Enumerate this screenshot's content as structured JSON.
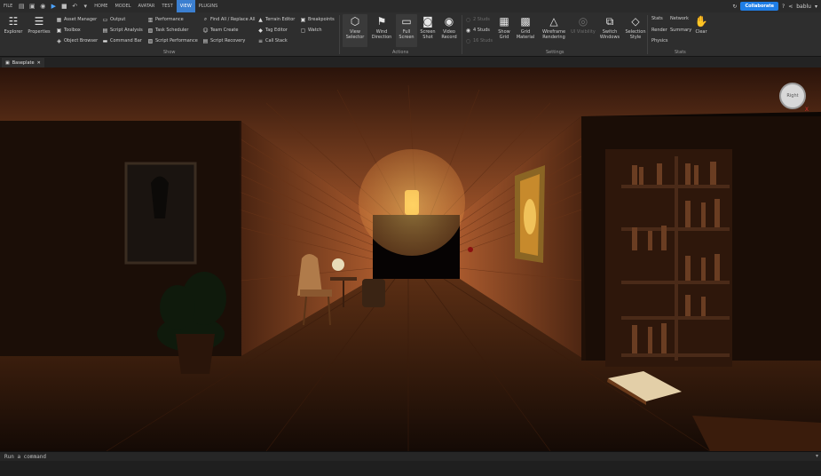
{
  "menubar": {
    "file": "FILE",
    "tabs": [
      "HOME",
      "MODEL",
      "AVATAR",
      "TEST",
      "VIEW",
      "PLUGINS"
    ],
    "active_tab": "VIEW",
    "collaborate": "Collaborate",
    "user": "bablu"
  },
  "ribbon": {
    "show": {
      "explorer": "Explorer",
      "properties": "Properties",
      "col1": [
        "Asset Manager",
        "Toolbox",
        "Object Browser"
      ],
      "col2": [
        "Output",
        "Script Analysis",
        "Command Bar"
      ],
      "col3": [
        "Performance",
        "Task Scheduler",
        "Script Performance"
      ],
      "col4": [
        "Find All / Replace All",
        "Team Create",
        "Script Recovery"
      ],
      "col5": [
        "Terrain Editor",
        "Tag Editor",
        "Call Stack"
      ],
      "col6": [
        "Breakpoints",
        "Watch"
      ],
      "label": "Show"
    },
    "actions": {
      "view_selector": "View\nSelector",
      "wind_direction": "Wind\nDirection",
      "full_screen": "Full\nScreen",
      "screen_shot": "Screen\nShot",
      "video_record": "Video\nRecord",
      "label": "Actions"
    },
    "settings": {
      "studs": [
        "2 Studs",
        "4 Studs",
        "16 Studs"
      ],
      "show_grid": "Show\nGrid",
      "grid_material": "Grid\nMaterial",
      "wireframe": "Wireframe\nRendering",
      "ui_visibility": "UI Visibility",
      "switch_windows": "Switch\nWindows",
      "selection_style": "Selection\nStyle",
      "label": "Settings"
    },
    "stats": {
      "col1": [
        "Stats",
        "Render",
        "Physics"
      ],
      "col2": [
        "Network",
        "Summary"
      ],
      "clear": "Clear",
      "label": "Stats"
    }
  },
  "document_tab": {
    "title": "Baseplate"
  },
  "viewport": {
    "view_cube_label": "Right",
    "axis_label": "X"
  },
  "command_bar": {
    "placeholder": "Run a command"
  },
  "colors": {
    "accent": "#1f7ee6",
    "active_tab": "#3b7fd0",
    "wood_lit": "#a0552c",
    "lamp": "#ffd45a"
  }
}
